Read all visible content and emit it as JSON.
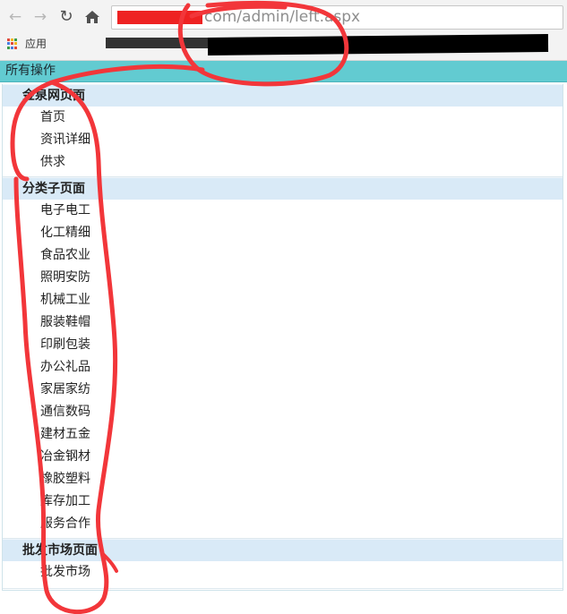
{
  "browser": {
    "url_visible": "com/admin/left.aspx",
    "bookmarks_label": "应用",
    "apps_icon_colors": [
      "#e04a3a",
      "#f3b51d",
      "#3b9d4a",
      "#4a7de0",
      "#e04a3a",
      "#f3b51d",
      "#3b9d4a",
      "#4a7de0",
      "#e04a3a"
    ]
  },
  "panel": {
    "title": "所有操作"
  },
  "menu": {
    "groups": [
      {
        "title": "金泉网页面",
        "items": [
          "首页",
          "资讯详细",
          "供求"
        ]
      },
      {
        "title": "分类子页面",
        "items": [
          "电子电工",
          "化工精细",
          "食品农业",
          "照明安防",
          "机械工业",
          "服装鞋帽",
          "印刷包装",
          "办公礼品",
          "家居家纺",
          "通信数码",
          "建材五金",
          "冶金钢材",
          "橡胶塑料",
          "库存加工",
          "服务合作"
        ]
      },
      {
        "title": "批发市场页面",
        "items": [
          "批发市场"
        ]
      }
    ]
  },
  "annotation": {
    "stroke_color": "#f2363a"
  }
}
